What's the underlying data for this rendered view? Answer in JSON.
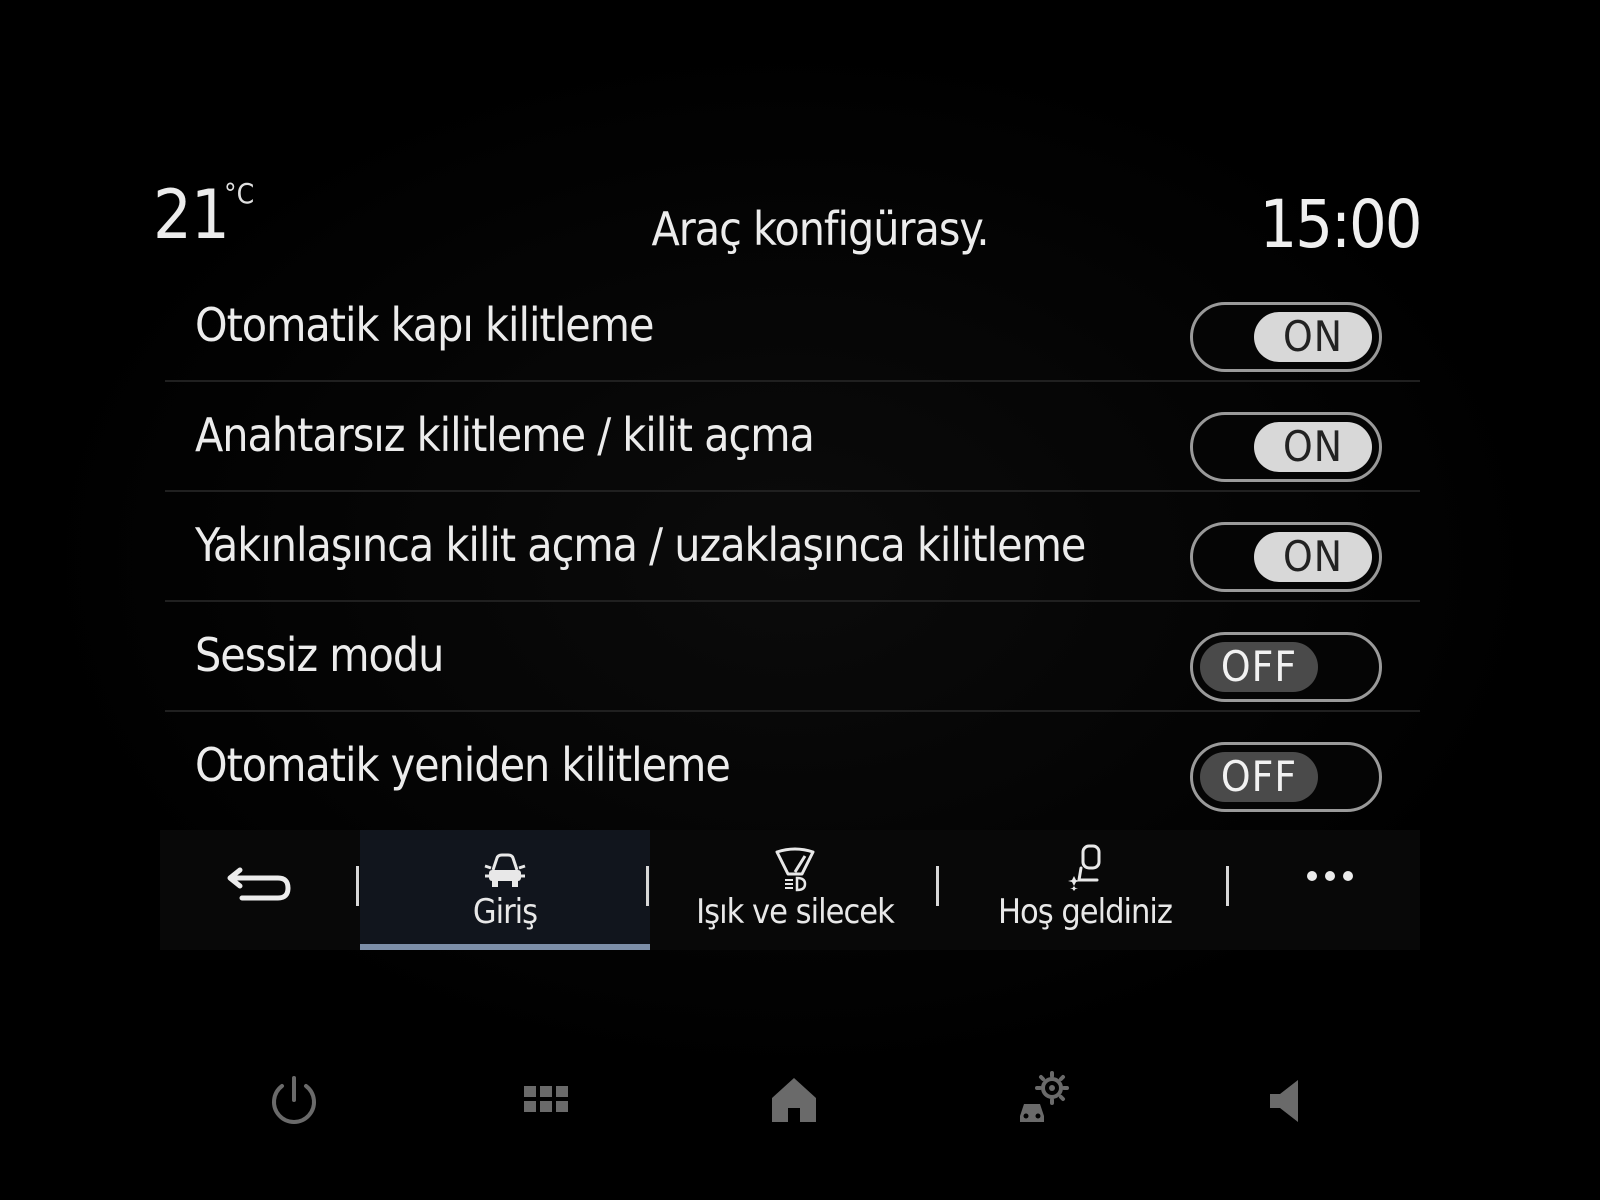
{
  "header": {
    "temperature": "21",
    "temperature_unit": "°C",
    "title": "Araç konfigürasy.",
    "clock": "15:00"
  },
  "settings": [
    {
      "label": "Otomatik kapı kilitleme",
      "state": "ON"
    },
    {
      "label": "Anahtarsız kilitleme / kilit açma",
      "state": "ON"
    },
    {
      "label": "Yakınlaşınca kilit açma / uzaklaşınca kilitleme",
      "state": "ON"
    },
    {
      "label": "Sessiz modu",
      "state": "OFF"
    },
    {
      "label": "Otomatik yeniden kilitleme",
      "state": "OFF"
    }
  ],
  "tabs": [
    {
      "label": "Giriş",
      "icon": "car-front-icon",
      "active": true
    },
    {
      "label": "Işık ve silecek",
      "icon": "light-wiper-icon",
      "active": false
    },
    {
      "label": "Hoş geldiniz",
      "icon": "welcome-seat-icon",
      "active": false
    }
  ],
  "tabbar_icons": {
    "back": "back-arrow-icon",
    "more": "more-dots-icon"
  },
  "bottom_nav": [
    "power-icon",
    "apps-grid-icon",
    "home-icon",
    "car-settings-icon",
    "volume-icon"
  ],
  "colors": {
    "active_tab_underline": "#7d8fa9",
    "toggle_on_knob": "#d8d8d8",
    "toggle_off_knob": "#4a4a4a"
  }
}
